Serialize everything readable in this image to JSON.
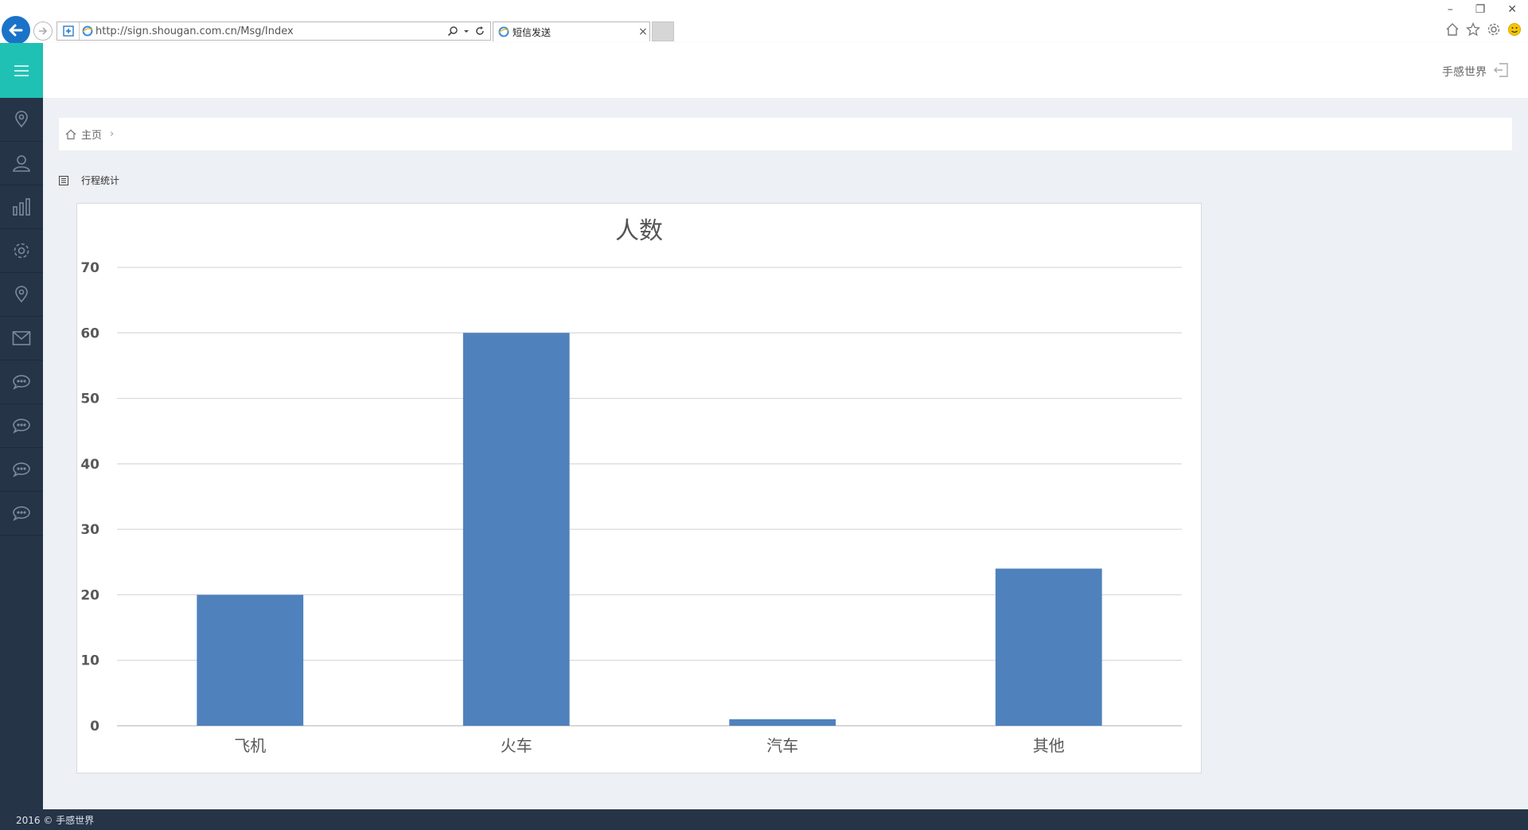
{
  "browser": {
    "url": "http://sign.shougan.com.cn/Msg/Index",
    "tab_title": "短信发送",
    "tab_close": "×",
    "win_min": "–",
    "win_restore": "❐",
    "win_close": "✕"
  },
  "header": {
    "user_name": "手感世界"
  },
  "sidebar": {
    "items": [
      "location-pin-icon",
      "user-icon",
      "bar-chart-icon",
      "gear-icon",
      "location-pin-icon",
      "mail-icon",
      "chat-icon",
      "chat-icon",
      "chat-icon",
      "chat-icon"
    ]
  },
  "breadcrumb": {
    "home": "主页",
    "separator": "›"
  },
  "section": {
    "title": "行程统计"
  },
  "chart_data": {
    "type": "bar",
    "title": "人数",
    "categories": [
      "飞机",
      "火车",
      "汽车",
      "其他"
    ],
    "values": [
      20,
      60,
      1,
      24
    ],
    "ylim": [
      0,
      70
    ],
    "yticks": [
      0,
      10,
      20,
      30,
      40,
      50,
      60,
      70
    ],
    "grid": true,
    "bar_color": "#4f81bd"
  },
  "footer": {
    "text": "2016 © 手感世界"
  },
  "colors": {
    "accent": "#1fc1b5",
    "sidebar_bg": "#263448",
    "content_bg": "#edf0f4"
  }
}
